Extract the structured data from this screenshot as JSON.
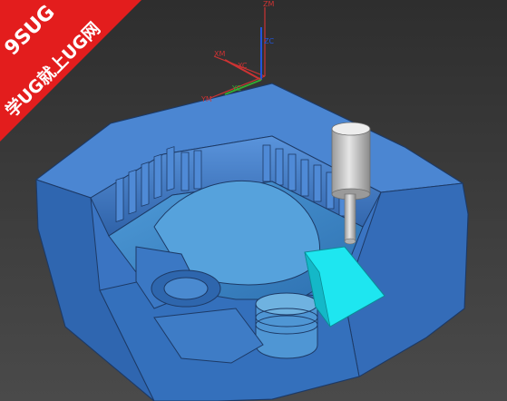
{
  "watermark": {
    "line1": "9SUG",
    "line2": "学UG就上UG网",
    "color": "#e31d1d"
  },
  "triad_absolute": {
    "z": "ZM",
    "x": "XM",
    "y": "YM",
    "color": "#cc3333"
  },
  "triad_work": {
    "z": "ZC",
    "x": "XC",
    "y": "YC",
    "z_color": "#2255dd",
    "x_color": "#cc3333",
    "y_color": "#33aa33"
  },
  "viewport": {
    "background": "#3b3b3b"
  },
  "model": {
    "body_color": "#3d78c8",
    "toolpath_highlight_color": "#1ee6f0",
    "tool_color": "#c8c8c8"
  }
}
